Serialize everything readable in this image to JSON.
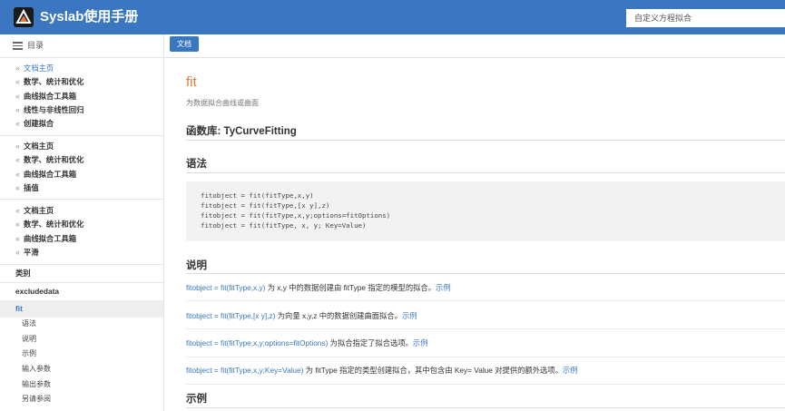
{
  "header": {
    "title": "Syslab使用手册",
    "search_value": "自定义方程拟合"
  },
  "sidebar": {
    "toc_label": "目录",
    "groups": [
      {
        "items": [
          {
            "label": "文档主页",
            "link": true
          },
          {
            "label": "数学、统计和优化",
            "link": false
          },
          {
            "label": "曲线拟合工具箱",
            "link": false
          },
          {
            "label": "线性与非线性回归",
            "link": false
          },
          {
            "label": "创建拟合",
            "link": false
          }
        ]
      },
      {
        "items": [
          {
            "label": "文档主页",
            "link": false
          },
          {
            "label": "数学、统计和优化",
            "link": false
          },
          {
            "label": "曲线拟合工具箱",
            "link": false
          },
          {
            "label": "插值",
            "link": false
          }
        ]
      },
      {
        "items": [
          {
            "label": "文档主页",
            "link": false
          },
          {
            "label": "数学、统计和优化",
            "link": false
          },
          {
            "label": "曲线拟合工具箱",
            "link": false
          },
          {
            "label": "平滑",
            "link": false
          }
        ]
      }
    ],
    "category": "类别",
    "sibling": "excludedata",
    "current": "fit",
    "subitems": [
      "语法",
      "说明",
      "示例",
      "输入参数",
      "输出参数",
      "另请参阅"
    ]
  },
  "content": {
    "tab_label": "文档",
    "title": "fit",
    "subtitle": "为数据拟合曲线或曲面",
    "library_heading": "函数库: TyCurveFitting",
    "syntax_heading": "语法",
    "syntax_lines": [
      "fitobject = fit(fitType,x,y)",
      "fitobject = fit(fitType,[x y],z)",
      "fitobject = fit(fitType,x,y;options=fitOptions)",
      "fitobject = fit(fitType, x, y; Key=Value)"
    ],
    "description_heading": "说明",
    "descriptions": [
      {
        "code": "fitobject = fit(fitType,x,y)",
        "text": " 为 x,y 中的数据创建由 fitType 指定的模型的拟合。",
        "example": "示例"
      },
      {
        "code": "fitobject = fit(fitType,[x y],z)",
        "text": " 为向量 x,y,z 中的数据创建曲面拟合。",
        "example": "示例"
      },
      {
        "code": "fitobject = fit(fitType,x,y;options=fitOptions)",
        "text": " 为拟合指定了拟合选项。",
        "example": "示例"
      },
      {
        "code": "fitobject = fit(fitType,x,y;Key=Value)",
        "text": " 为 fitType 指定的类型创建拟合，其中包含由 Key= Value 对提供的额外选项。",
        "example": "示例"
      }
    ],
    "examples_heading": "示例"
  }
}
